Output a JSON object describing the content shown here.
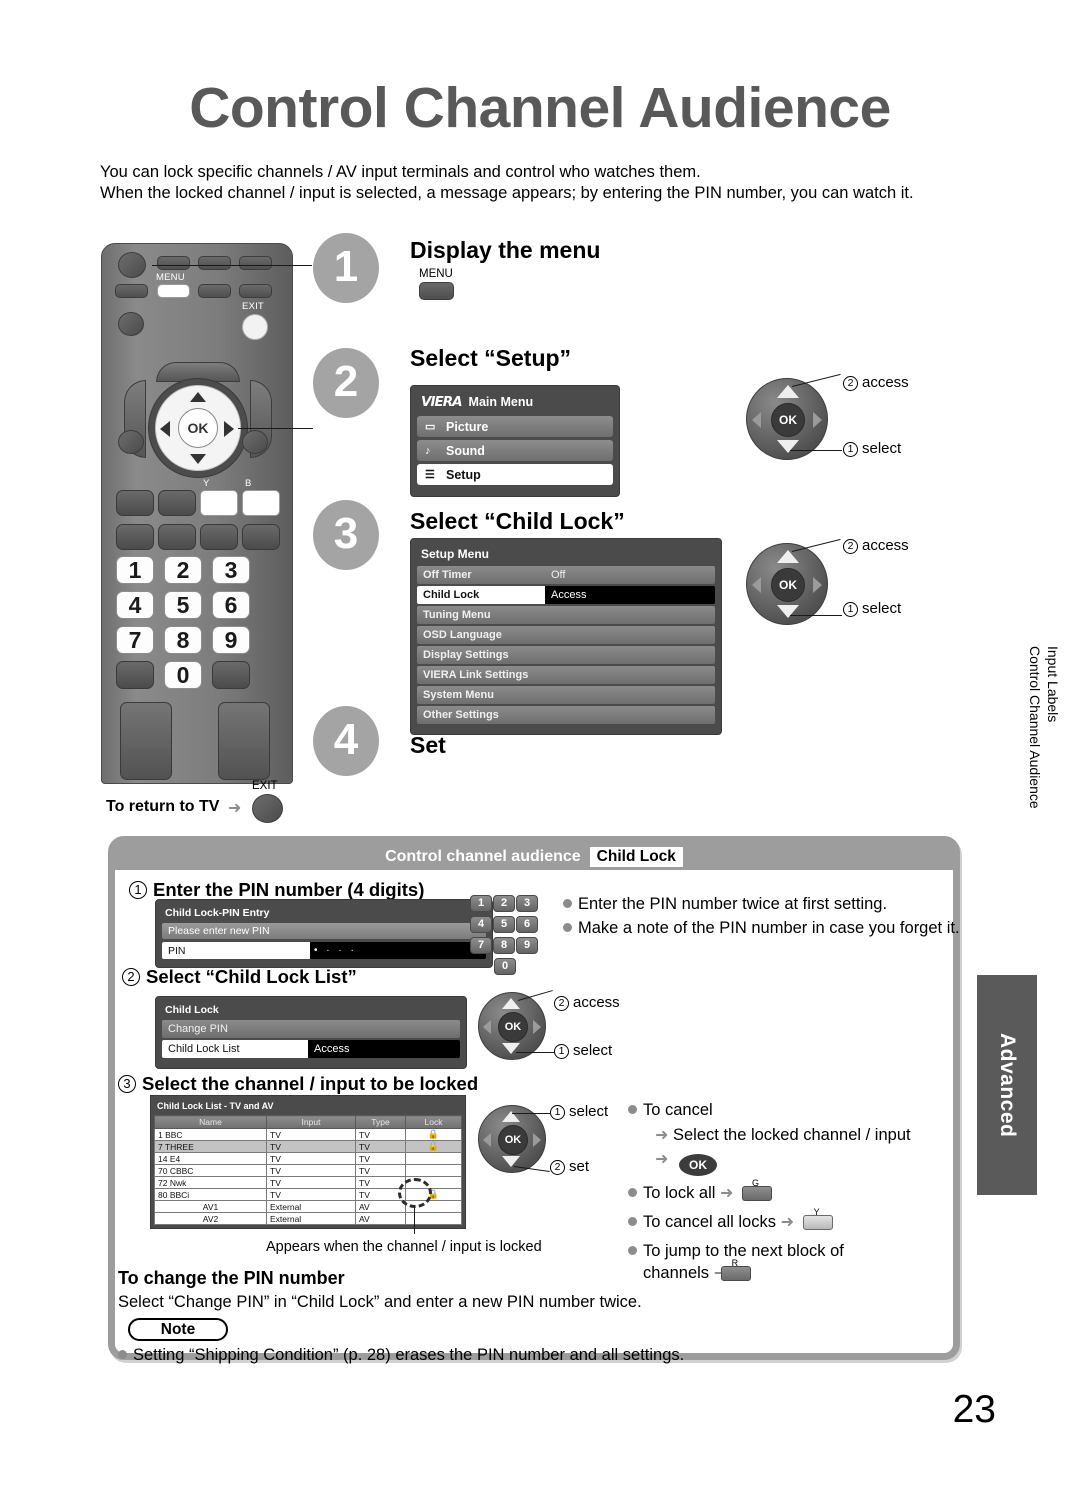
{
  "page": {
    "title": "Control Channel Audience",
    "intro": "You can lock specific channels / AV input terminals and control who watches them.\nWhen the locked channel / input is selected, a message appears; by entering the PIN number, you can watch it.",
    "number": "23"
  },
  "sidebar": {
    "rotated_text": "Input Labels\nControl Channel Audience",
    "section_tab": "Advanced"
  },
  "remote": {
    "menu_label": "MENU",
    "exit_label": "EXIT",
    "ok_label": "OK",
    "color_y": "Y",
    "color_b": "B",
    "keys": [
      "1",
      "2",
      "3",
      "4",
      "5",
      "6",
      "7",
      "8",
      "9",
      "0"
    ],
    "return_to_tv": "To return to TV",
    "return_arrow": "➜"
  },
  "steps": [
    {
      "num": "1",
      "heading": "Display the menu",
      "button_label": "MENU"
    },
    {
      "num": "2",
      "heading": "Select “Setup”",
      "menu": {
        "logo": "VIERA",
        "title": "Main Menu",
        "items": [
          {
            "icon": "picture-icon",
            "glyph": "▭",
            "label": "Picture",
            "selected": false
          },
          {
            "icon": "sound-icon",
            "glyph": "♪",
            "label": "Sound",
            "selected": false
          },
          {
            "icon": "setup-icon",
            "glyph": "☰",
            "label": "Setup",
            "selected": true
          }
        ]
      },
      "callouts": [
        {
          "num": "2",
          "label": "access"
        },
        {
          "num": "1",
          "label": "select"
        }
      ]
    },
    {
      "num": "3",
      "heading": "Select “Child Lock”",
      "menu": {
        "title": "Setup Menu",
        "rows": [
          {
            "label": "Off Timer",
            "value": "Off",
            "selected": false
          },
          {
            "label": "Child Lock",
            "value": "Access",
            "selected": true
          },
          {
            "label": "Tuning Menu",
            "value": "",
            "selected": false
          },
          {
            "label": "OSD Language",
            "value": "",
            "selected": false
          },
          {
            "label": "Display Settings",
            "value": "",
            "selected": false
          },
          {
            "label": "VIERA Link Settings",
            "value": "",
            "selected": false
          },
          {
            "label": "System Menu",
            "value": "",
            "selected": false
          },
          {
            "label": "Other Settings",
            "value": "",
            "selected": false
          }
        ]
      },
      "callouts": [
        {
          "num": "2",
          "label": "access"
        },
        {
          "num": "1",
          "label": "select"
        }
      ]
    },
    {
      "num": "4",
      "heading": "Set"
    }
  ],
  "panel": {
    "header_title": "Control channel audience",
    "header_chip": "Child Lock",
    "sections": [
      {
        "num": "1",
        "heading": "Enter the PIN number (4 digits)",
        "osd": {
          "title": "Child Lock-PIN Entry",
          "banner": "Please enter new PIN",
          "field_label": "PIN",
          "field_value": "• · · ·"
        },
        "keypad": [
          "1",
          "2",
          "3",
          "4",
          "5",
          "6",
          "7",
          "8",
          "9",
          "0"
        ],
        "bullets": [
          "Enter the PIN number twice at first setting.",
          "Make a note of the PIN number in case you forget it."
        ]
      },
      {
        "num": "2",
        "heading": "Select “Child Lock List”",
        "osd": {
          "title": "Child Lock",
          "rows": [
            {
              "label": "Change PIN",
              "value": "",
              "selected": false
            },
            {
              "label": "Child Lock List",
              "value": "Access",
              "selected": true
            }
          ]
        },
        "callouts": [
          {
            "num": "2",
            "label": "access"
          },
          {
            "num": "1",
            "label": "select"
          }
        ]
      },
      {
        "num": "3",
        "heading": "Select the channel / input to be locked",
        "table": {
          "title": "Child Lock List - TV and AV",
          "columns": [
            "Name",
            "Input",
            "Type",
            "Lock"
          ],
          "rows": [
            {
              "name": "1  BBC",
              "input": "TV",
              "type": "TV",
              "lock": "locked",
              "alt": false
            },
            {
              "name": "7  THREE",
              "input": "TV",
              "type": "TV",
              "lock": "locked",
              "alt": true
            },
            {
              "name": "14  E4",
              "input": "TV",
              "type": "TV",
              "lock": "",
              "alt": false
            },
            {
              "name": "70  CBBC",
              "input": "TV",
              "type": "TV",
              "lock": "",
              "alt": false
            },
            {
              "name": "72  Nwk",
              "input": "TV",
              "type": "TV",
              "lock": "",
              "alt": false
            },
            {
              "name": "80  BBCi",
              "input": "TV",
              "type": "TV",
              "lock": "cursor",
              "alt": false
            },
            {
              "name": "AV1",
              "input": "External",
              "type": "AV",
              "lock": "",
              "alt": false
            },
            {
              "name": "AV2",
              "input": "External",
              "type": "AV",
              "lock": "",
              "alt": false
            }
          ]
        },
        "caption": "Appears when the channel / input is locked",
        "callouts": [
          {
            "num": "1",
            "label": "select"
          },
          {
            "num": "2",
            "label": "set"
          }
        ],
        "bullets": [
          {
            "text": "To cancel",
            "sub": [
              {
                "arrow": "➜",
                "text": "Select the locked channel / input"
              },
              {
                "arrow": "➜",
                "text": "",
                "button": "OK"
              }
            ]
          },
          {
            "text": "To lock all",
            "arrow": "➜",
            "colour_key": "G"
          },
          {
            "text": "To cancel all locks",
            "arrow": "➜",
            "colour_key": "Y"
          },
          {
            "text": "To jump to the next block of channels",
            "arrow": "➜",
            "colour_key": "R"
          }
        ]
      }
    ],
    "change_pin": {
      "heading": "To change the PIN number",
      "body": "Select “Change PIN” in “Child Lock” and enter a new PIN number twice."
    },
    "note": {
      "badge": "Note",
      "items": [
        "Setting “Shipping Condition” (p. 28) erases the PIN number and all settings."
      ]
    }
  },
  "colors": {
    "title_grey": "#595959",
    "panel_border": "#9d9d9d",
    "tab_dark": "#5a5a5a",
    "step_circle": "#a4a4a4",
    "bullet_dot": "#8c8c8c"
  }
}
